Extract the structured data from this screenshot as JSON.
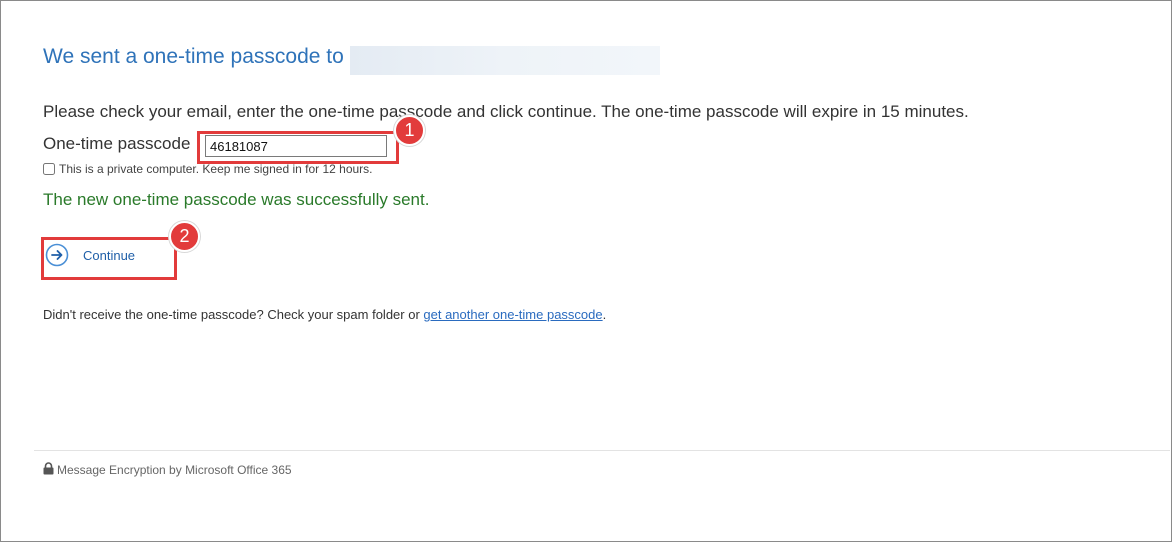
{
  "heading": {
    "text": "We sent a one-time passcode to"
  },
  "instruction": "Please check your email, enter the one-time passcode and click continue. The one-time passcode will expire in 15 minutes.",
  "passcode": {
    "label": "One-time passcode",
    "value": "46181087"
  },
  "keep_signed_in": {
    "label": "This is a private computer. Keep me signed in for 12 hours.",
    "checked": false
  },
  "success_message": "The new one-time passcode was successfully sent.",
  "continue_button": {
    "label": "Continue",
    "icon": "arrow-right-circle-icon"
  },
  "resend": {
    "prefix": "Didn't receive the one-time passcode? Check your spam folder or ",
    "link_text": "get another one-time passcode",
    "suffix": "."
  },
  "footer": {
    "icon": "lock-icon",
    "text": "Message Encryption by Microsoft Office 365"
  },
  "annotations": {
    "badge_1": "1",
    "badge_2": "2"
  },
  "colors": {
    "heading": "#2f73b9",
    "success": "#2a7a2a",
    "link": "#2a6bbf",
    "highlight": "#e23b3b"
  }
}
